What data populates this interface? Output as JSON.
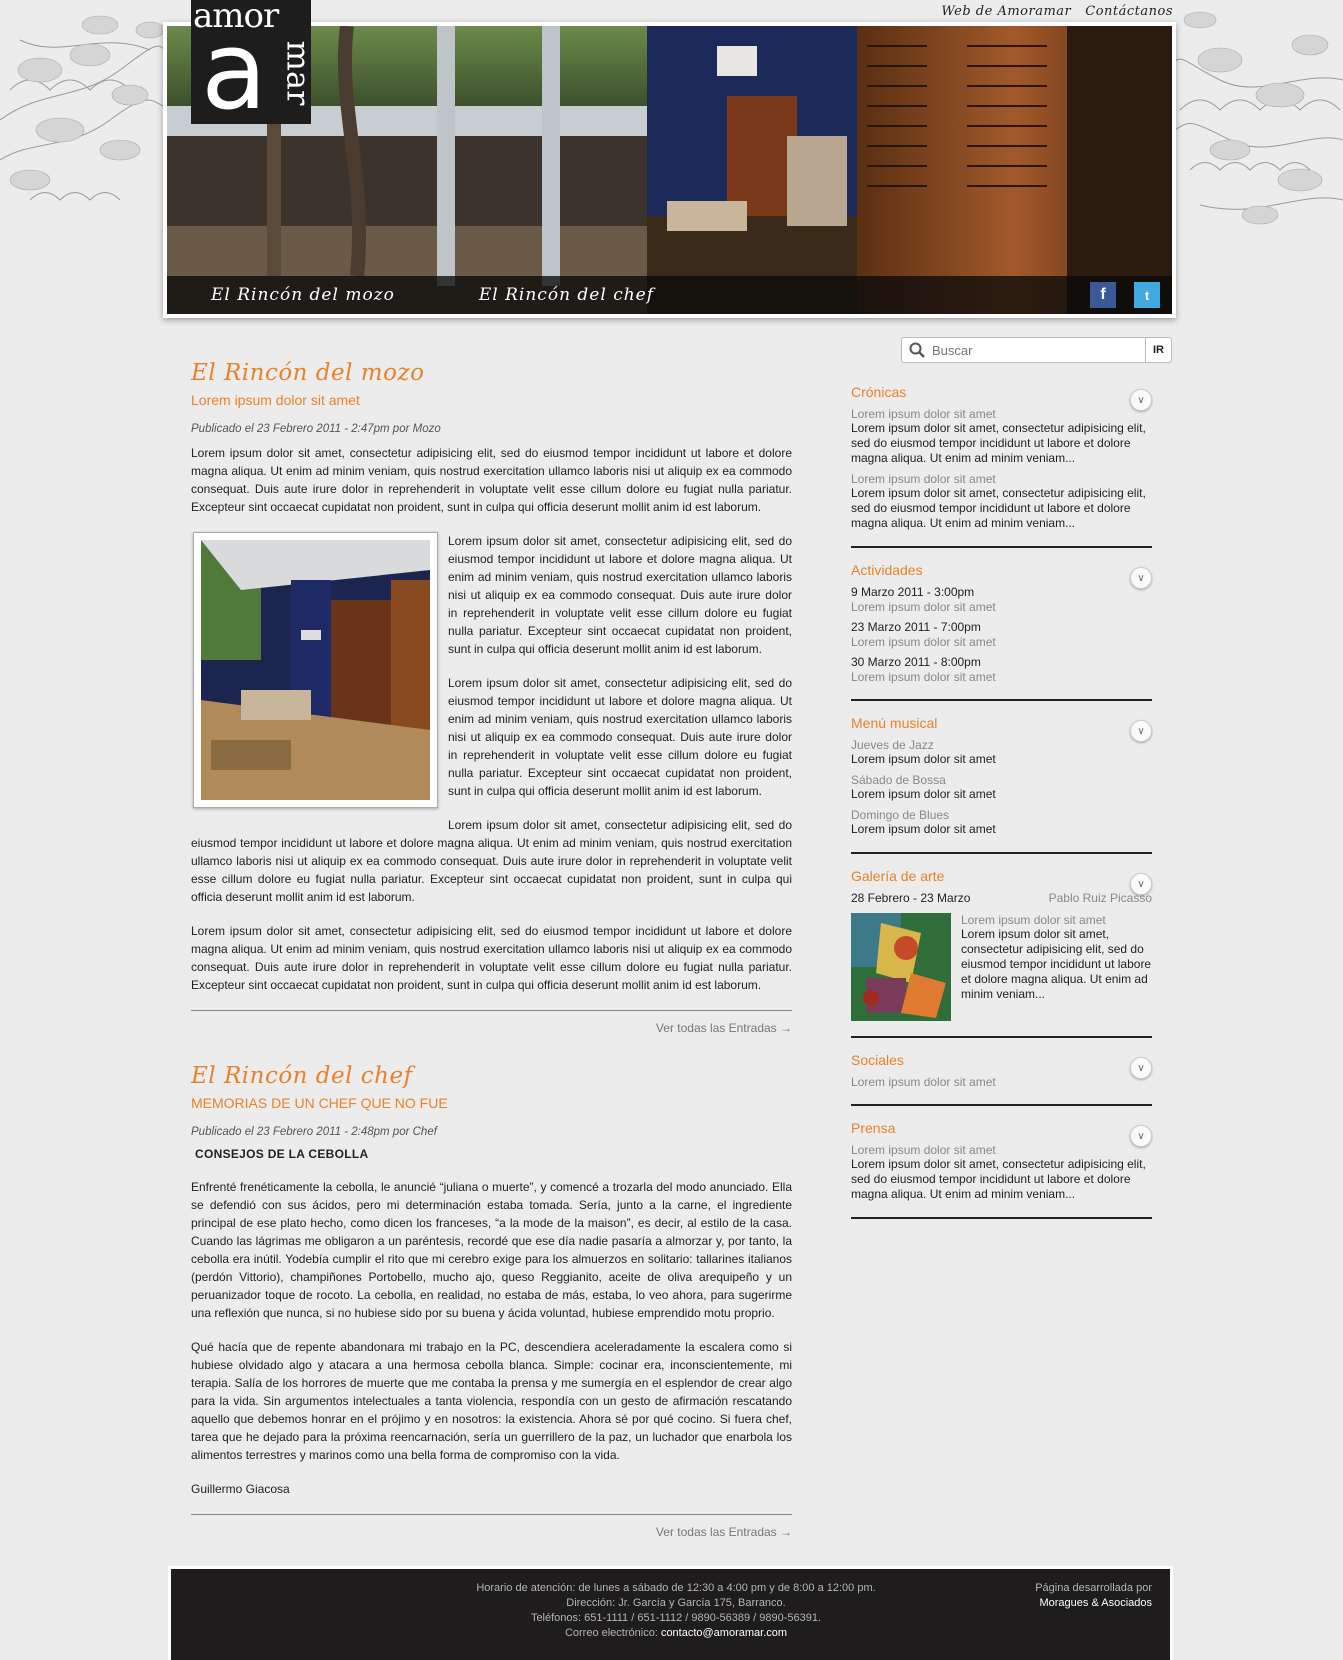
{
  "topnav": {
    "web": "Web de Amoramar",
    "contact": "Contáctanos"
  },
  "logo": {
    "top": "amor",
    "letter": "a",
    "side": "mar"
  },
  "hero": {
    "nav_mozo": "El Rincón del mozo",
    "nav_chef": "El Rincón del chef",
    "facebook": "f",
    "twitter": "t"
  },
  "search": {
    "placeholder": "Buscar",
    "button": "IR"
  },
  "mozo": {
    "section": "El Rincón del mozo",
    "title": "Lorem ipsum dolor sit amet",
    "meta": "Publicado el 23 Febrero 2011 - 2:47pm por Mozo",
    "p1": "Lorem ipsum dolor sit amet, consectetur adipisicing elit, sed do eiusmod tempor incididunt ut labore et dolore magna aliqua. Ut enim ad minim veniam, quis nostrud exercitation ullamco laboris nisi ut aliquip ex ea commodo consequat. Duis aute irure dolor in reprehenderit in voluptate velit esse cillum dolore eu fugiat nulla pariatur. Excepteur sint occaecat cupidatat non proident, sunt in culpa qui officia deserunt mollit anim id est laborum.",
    "p2": "Lorem ipsum dolor sit amet, consectetur adipisicing elit, sed do eiusmod tempor incididunt ut labore et dolore magna aliqua. Ut enim ad minim veniam, quis nostrud exercitation ullamco laboris nisi ut aliquip ex ea commodo consequat. Duis aute irure dolor in reprehenderit in voluptate velit esse cillum dolore eu fugiat nulla pariatur. Excepteur sint occaecat cupidatat non proident, sunt in culpa qui officia deserunt mollit anim id est laborum.",
    "p3": "Lorem ipsum dolor sit amet, consectetur adipisicing elit, sed do eiusmod tempor incididunt ut labore et dolore magna aliqua. Ut enim ad minim veniam, quis nostrud exercitation ullamco laboris nisi ut aliquip ex ea commodo consequat. Duis aute irure dolor in reprehenderit in voluptate velit esse cillum dolore eu fugiat nulla pariatur. Excepteur sint occaecat cupidatat non proident, sunt in culpa qui officia deserunt mollit anim id est laborum.",
    "p4": "Lorem ipsum dolor sit amet, consectetur adipisicing elit, sed do eiusmod tempor incididunt ut labore et dolore magna aliqua. Ut enim ad minim veniam, quis nostrud exercitation ullamco laboris nisi ut aliquip ex ea commodo consequat. Duis aute irure dolor in reprehenderit in voluptate velit esse cillum dolore eu fugiat nulla pariatur. Excepteur sint occaecat cupidatat non proident, sunt in culpa qui officia deserunt mollit anim id est laborum.",
    "p5": "Lorem ipsum dolor sit amet, consectetur adipisicing elit, sed do eiusmod tempor incididunt ut labore et dolore magna aliqua. Ut enim ad minim veniam, quis nostrud exercitation ullamco laboris nisi ut aliquip ex ea commodo consequat. Duis aute irure dolor in reprehenderit in voluptate velit esse cillum dolore eu fugiat nulla pariatur. Excepteur sint occaecat cupidatat non proident, sunt in culpa qui officia deserunt mollit anim id est laborum.",
    "readmore": "Ver todas las Entradas →"
  },
  "chef": {
    "section": "El Rincón del chef",
    "title": "MEMORIAS DE UN CHEF QUE NO FUE",
    "meta": "Publicado el 23 Febrero 2011 - 2:48pm por Chef",
    "subheading": "CONSEJOS DE LA CEBOLLA",
    "p1": "Enfrenté frenéticamente la cebolla, le anuncié “juliana o muerte”, y comencé a trozarla del modo anunciado. Ella se defendió con sus ácidos, pero mi determinación estaba tomada. Sería, junto a la carne, el ingrediente principal de ese plato hecho, como dicen los franceses, “a la mode de la maison”, es decir, al estilo de la casa. Cuando las lágrimas me obligaron a un paréntesis, recordé que ese día nadie pasaría a almorzar y, por tanto, la cebolla era inútil. Yodebía cumplir el  rito que mi cerebro exige para los almuerzos en solitario: tallarines italianos (perdón Vittorio), champiñones Portobello, mucho ajo, queso Reggianito,  aceite de oliva arequipeño y un peruanizador toque de rocoto. La cebolla, en realidad,  no estaba de más, estaba, lo veo ahora,  para sugerirme una reflexión que nunca, si no hubiese sido por su buena y ácida voluntad, hubiese emprendido motu proprio.",
    "p2": "Qué hacía que de repente abandonara mi trabajo en la PC, descendiera aceleradamente la escalera como si hubiese olvidado algo y atacara a una hermosa cebolla blanca. Simple: cocinar era, inconscientemente, mi terapia. Salía de los horrores de muerte que me contaba la prensa y me sumergía en el esplendor de crear algo para la vida. Sin argumentos intelectuales a tanta violencia, respondía con un gesto de afirmación rescatando aquello que debemos honrar en el prójimo y en nosotros: la existencia. Ahora sé por qué cocino. Si fuera chef, tarea que he dejado para la próxima reencarnación, sería un guerrillero de la paz, un luchador que enarbola los alimentos terrestres y marinos como una bella forma de compromiso con la vida.",
    "signature": "Guillermo Giacosa",
    "readmore": "Ver todas las Entradas →"
  },
  "sidebar": {
    "cronicas": {
      "title": "Crónicas",
      "items": [
        {
          "heading": "Lorem ipsum dolor sit amet",
          "text": "Lorem ipsum dolor sit amet, consectetur adipisicing elit, sed do eiusmod tempor incididunt ut labore et dolore magna aliqua. Ut enim ad minim veniam..."
        },
        {
          "heading": "Lorem ipsum dolor sit amet",
          "text": "Lorem ipsum dolor sit amet, consectetur adipisicing elit, sed do eiusmod tempor incididunt ut labore et dolore magna aliqua. Ut enim ad minim veniam..."
        }
      ]
    },
    "actividades": {
      "title": "Actividades",
      "items": [
        {
          "date": "9 Marzo 2011 - 3:00pm",
          "text": "Lorem ipsum dolor sit amet"
        },
        {
          "date": "23 Marzo 2011 - 7:00pm",
          "text": "Lorem ipsum dolor sit amet"
        },
        {
          "date": "30 Marzo 2011 - 8:00pm",
          "text": "Lorem ipsum dolor sit amet"
        }
      ]
    },
    "menu": {
      "title": "Menú musical",
      "items": [
        {
          "day": "Jueves de Jazz",
          "text": "Lorem ipsum dolor sit amet"
        },
        {
          "day": "Sábado de Bossa",
          "text": "Lorem ipsum dolor sit amet"
        },
        {
          "day": "Domingo de Blues",
          "text": "Lorem ipsum dolor sit amet"
        }
      ]
    },
    "galeria": {
      "title": "Galería de arte",
      "dates": "28 Febrero - 23 Marzo",
      "artist": "Pablo Ruiz Picasso",
      "heading": "Lorem ipsum dolor sit amet",
      "text": "Lorem ipsum dolor sit amet, consectetur adipisicing elit, sed do eiusmod tempor incididunt ut labore et dolore magna aliqua. Ut enim ad minim veniam..."
    },
    "sociales": {
      "title": "Sociales",
      "text": "Lorem ipsum dolor sit amet"
    },
    "prensa": {
      "title": "Prensa",
      "heading": "Lorem ipsum dolor sit amet",
      "text": "Lorem ipsum dolor sit amet, consectetur adipisicing elit, sed do eiusmod tempor incididunt ut labore et dolore magna aliqua. Ut enim ad minim veniam..."
    }
  },
  "footer": {
    "hours": "Horario de atención: de lunes a sábado de 12:30 a 4:00 pm y de 8:00 a 12:00 pm.",
    "address": "Dirección: Jr. García y García 175, Barranco.",
    "phones": "Teléfonos: 651-1111 / 651-1112 / 9890-56389 / 9890-56391.",
    "email_label": "Correo electrónico:",
    "email": "contacto@amoramar.com",
    "dev_label": "Página desarrollada por",
    "dev": "Moragues & Asociados"
  },
  "colors": {
    "accent": "#e8822a",
    "footer_bg": "#1e1c1c",
    "page_bg": "#ececec"
  }
}
